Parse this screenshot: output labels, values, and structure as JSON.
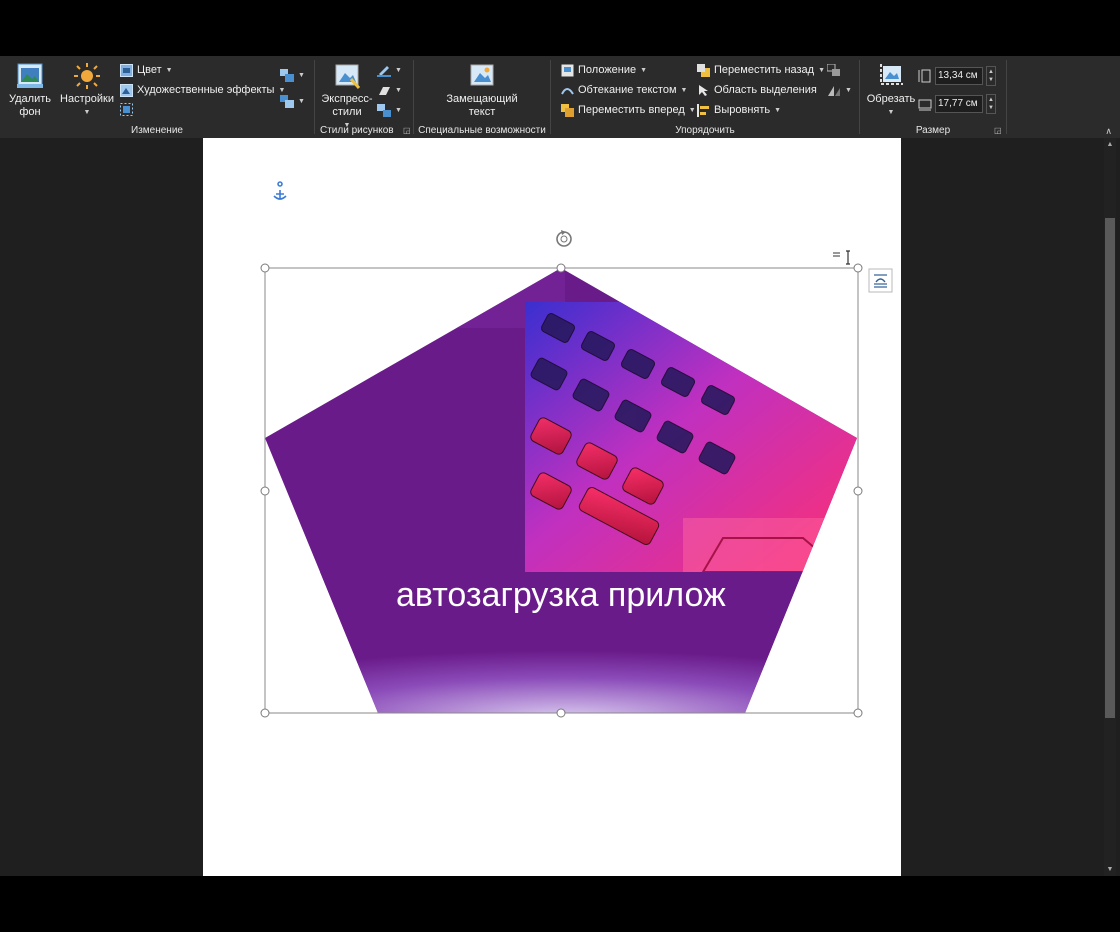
{
  "ribbon": {
    "adjust": {
      "remove_bg": "Удалить фон",
      "corrections": "Настройки",
      "color": "Цвет",
      "artistic": "Художественные эффекты",
      "title": "Изменение"
    },
    "styles": {
      "express": "Экспресс-стили",
      "title": "Стили рисунков"
    },
    "accessibility": {
      "alt_text": "Замещающий текст",
      "title": "Специальные возможности"
    },
    "arrange": {
      "position": "Положение",
      "wrap": "Обтекание текстом",
      "forward": "Переместить вперед",
      "backward": "Переместить назад",
      "selection_pane": "Область выделения",
      "align": "Выровнять",
      "title": "Упорядочить"
    },
    "size": {
      "crop": "Обрезать",
      "height": "13,34 см",
      "width": "17,77 см",
      "title": "Размер"
    }
  },
  "document": {
    "image_text": "автозагрузка прилож"
  },
  "colors": {
    "ribbon_bg": "#2b2b2b",
    "workspace_bg": "#1f1f1f",
    "purple": "#6a1b8a"
  }
}
